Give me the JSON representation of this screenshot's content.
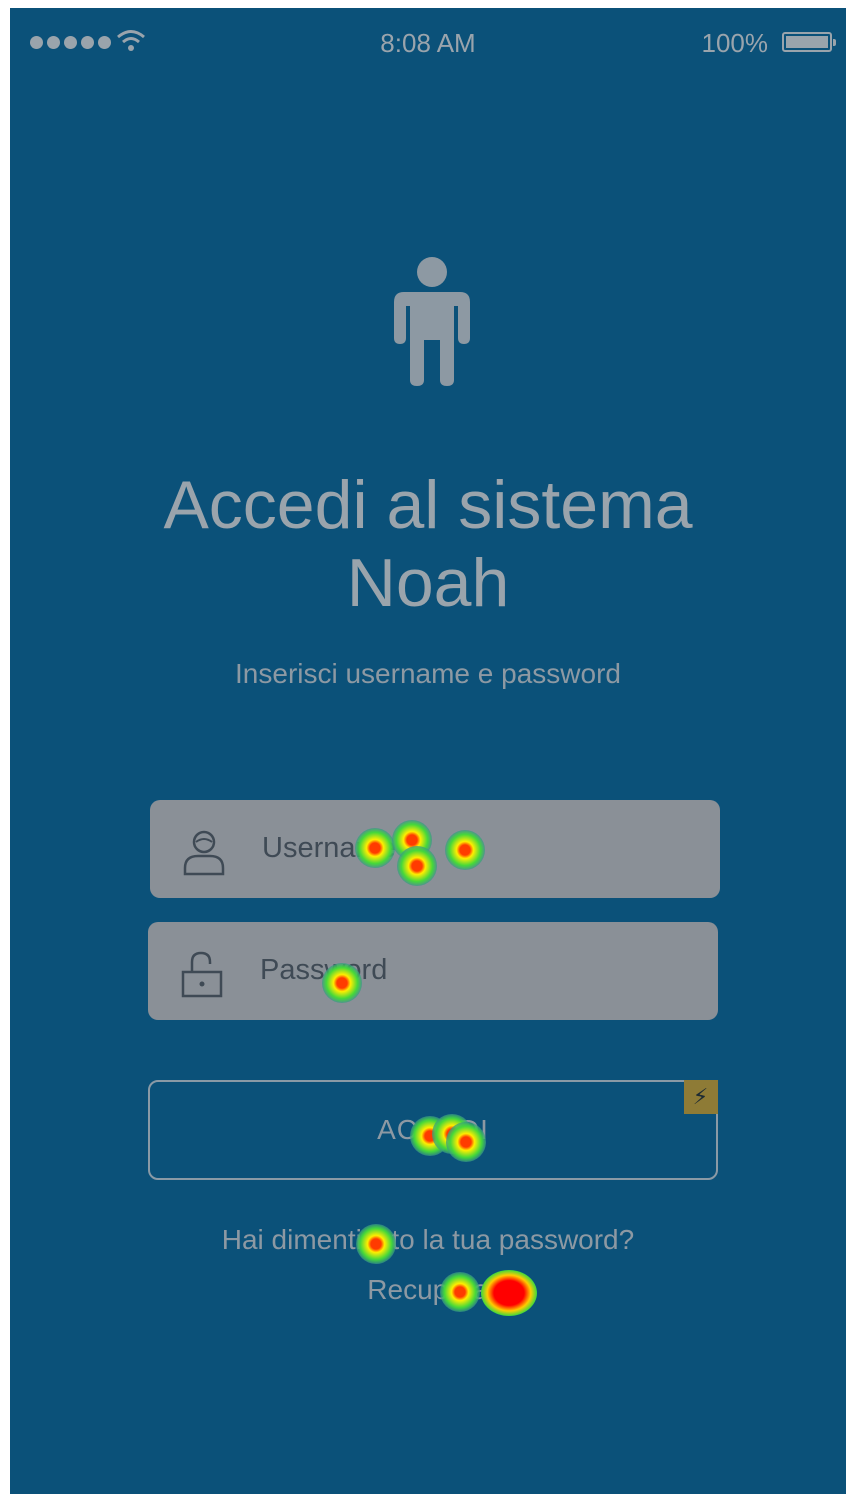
{
  "status_bar": {
    "time": "8:08 AM",
    "battery": "100%",
    "signal_icon": "signal-dots-icon",
    "wifi_icon": "wifi-icon",
    "battery_icon": "battery-icon"
  },
  "hero": {
    "icon": "person-icon",
    "title_line1": "Accedi al sistema",
    "title_line2": "Noah",
    "subtitle": "Inserisci username e password"
  },
  "form": {
    "username_placeholder": "Username",
    "username_icon": "user-icon",
    "password_placeholder": "Password",
    "password_icon": "unlock-icon",
    "submit_label": "ACCEDI",
    "flash_icon": "lightning-icon"
  },
  "links": {
    "forgot": "Hai dimenticato la tua password?",
    "recover": "Recupera"
  },
  "colors": {
    "background": "#0b5179",
    "field": "#8a9097",
    "text_muted": "#9aa4ac",
    "badge": "#8e7b36"
  }
}
